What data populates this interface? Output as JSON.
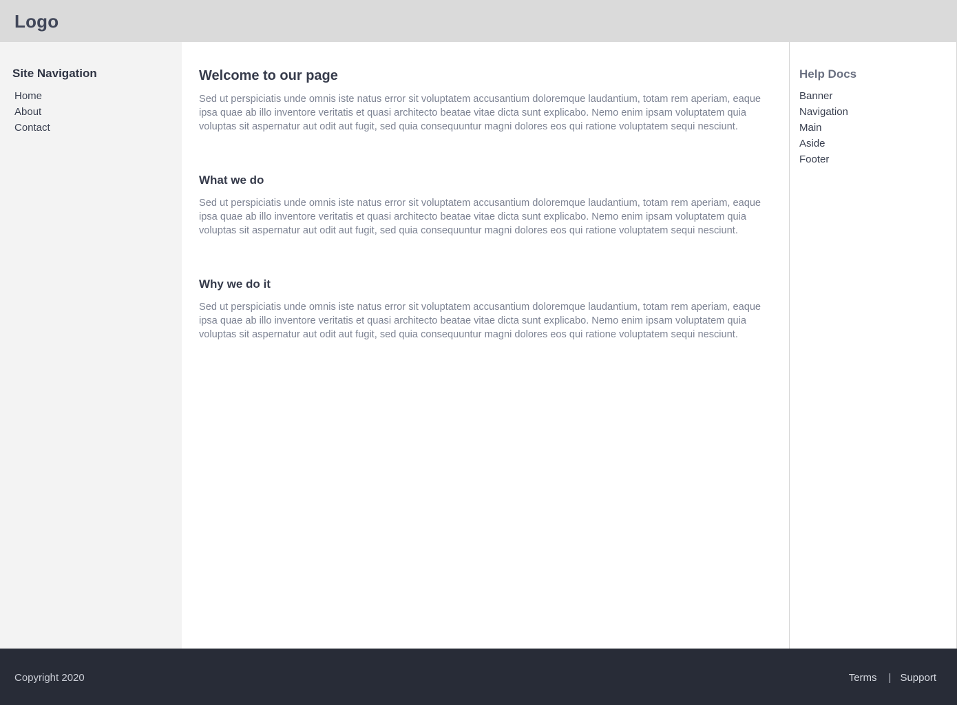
{
  "banner": {
    "logo": "Logo"
  },
  "sidebar": {
    "title": "Site Navigation",
    "items": [
      {
        "label": "Home"
      },
      {
        "label": "About"
      },
      {
        "label": "Contact"
      }
    ]
  },
  "main": {
    "sections": [
      {
        "heading": "Welcome to our page",
        "body": "Sed ut perspiciatis unde omnis iste natus error sit voluptatem accusantium doloremque laudantium, totam rem aperiam, eaque ipsa quae ab illo inventore veritatis et quasi architecto beatae vitae dicta sunt explicabo. Nemo enim ipsam voluptatem quia voluptas sit aspernatur aut odit aut fugit, sed quia consequuntur magni dolores eos qui ratione voluptatem sequi nesciunt."
      },
      {
        "heading": "What we do",
        "body": "Sed ut perspiciatis unde omnis iste natus error sit voluptatem accusantium doloremque laudantium, totam rem aperiam, eaque ipsa quae ab illo inventore veritatis et quasi architecto beatae vitae dicta sunt explicabo. Nemo enim ipsam voluptatem quia voluptas sit aspernatur aut odit aut fugit, sed quia consequuntur magni dolores eos qui ratione voluptatem sequi nesciunt."
      },
      {
        "heading": "Why we do it",
        "body": "Sed ut perspiciatis unde omnis iste natus error sit voluptatem accusantium doloremque laudantium, totam rem aperiam, eaque ipsa quae ab illo inventore veritatis et quasi architecto beatae vitae dicta sunt explicabo. Nemo enim ipsam voluptatem quia voluptas sit aspernatur aut odit aut fugit, sed quia consequuntur magni dolores eos qui ratione voluptatem sequi nesciunt."
      }
    ]
  },
  "aside": {
    "title": "Help Docs",
    "items": [
      {
        "label": "Banner"
      },
      {
        "label": "Navigation"
      },
      {
        "label": "Main"
      },
      {
        "label": "Aside"
      },
      {
        "label": "Footer"
      }
    ]
  },
  "footer": {
    "copyright": "Copyright 2020",
    "links": [
      {
        "label": "Terms"
      },
      {
        "label": "Support"
      }
    ],
    "separator": "|"
  },
  "colors": {
    "banner_bg": "#dadada",
    "sidebar_bg": "#f3f3f3",
    "footer_bg": "#282c37",
    "heading": "#363b4b",
    "body_text": "#7d8393"
  }
}
